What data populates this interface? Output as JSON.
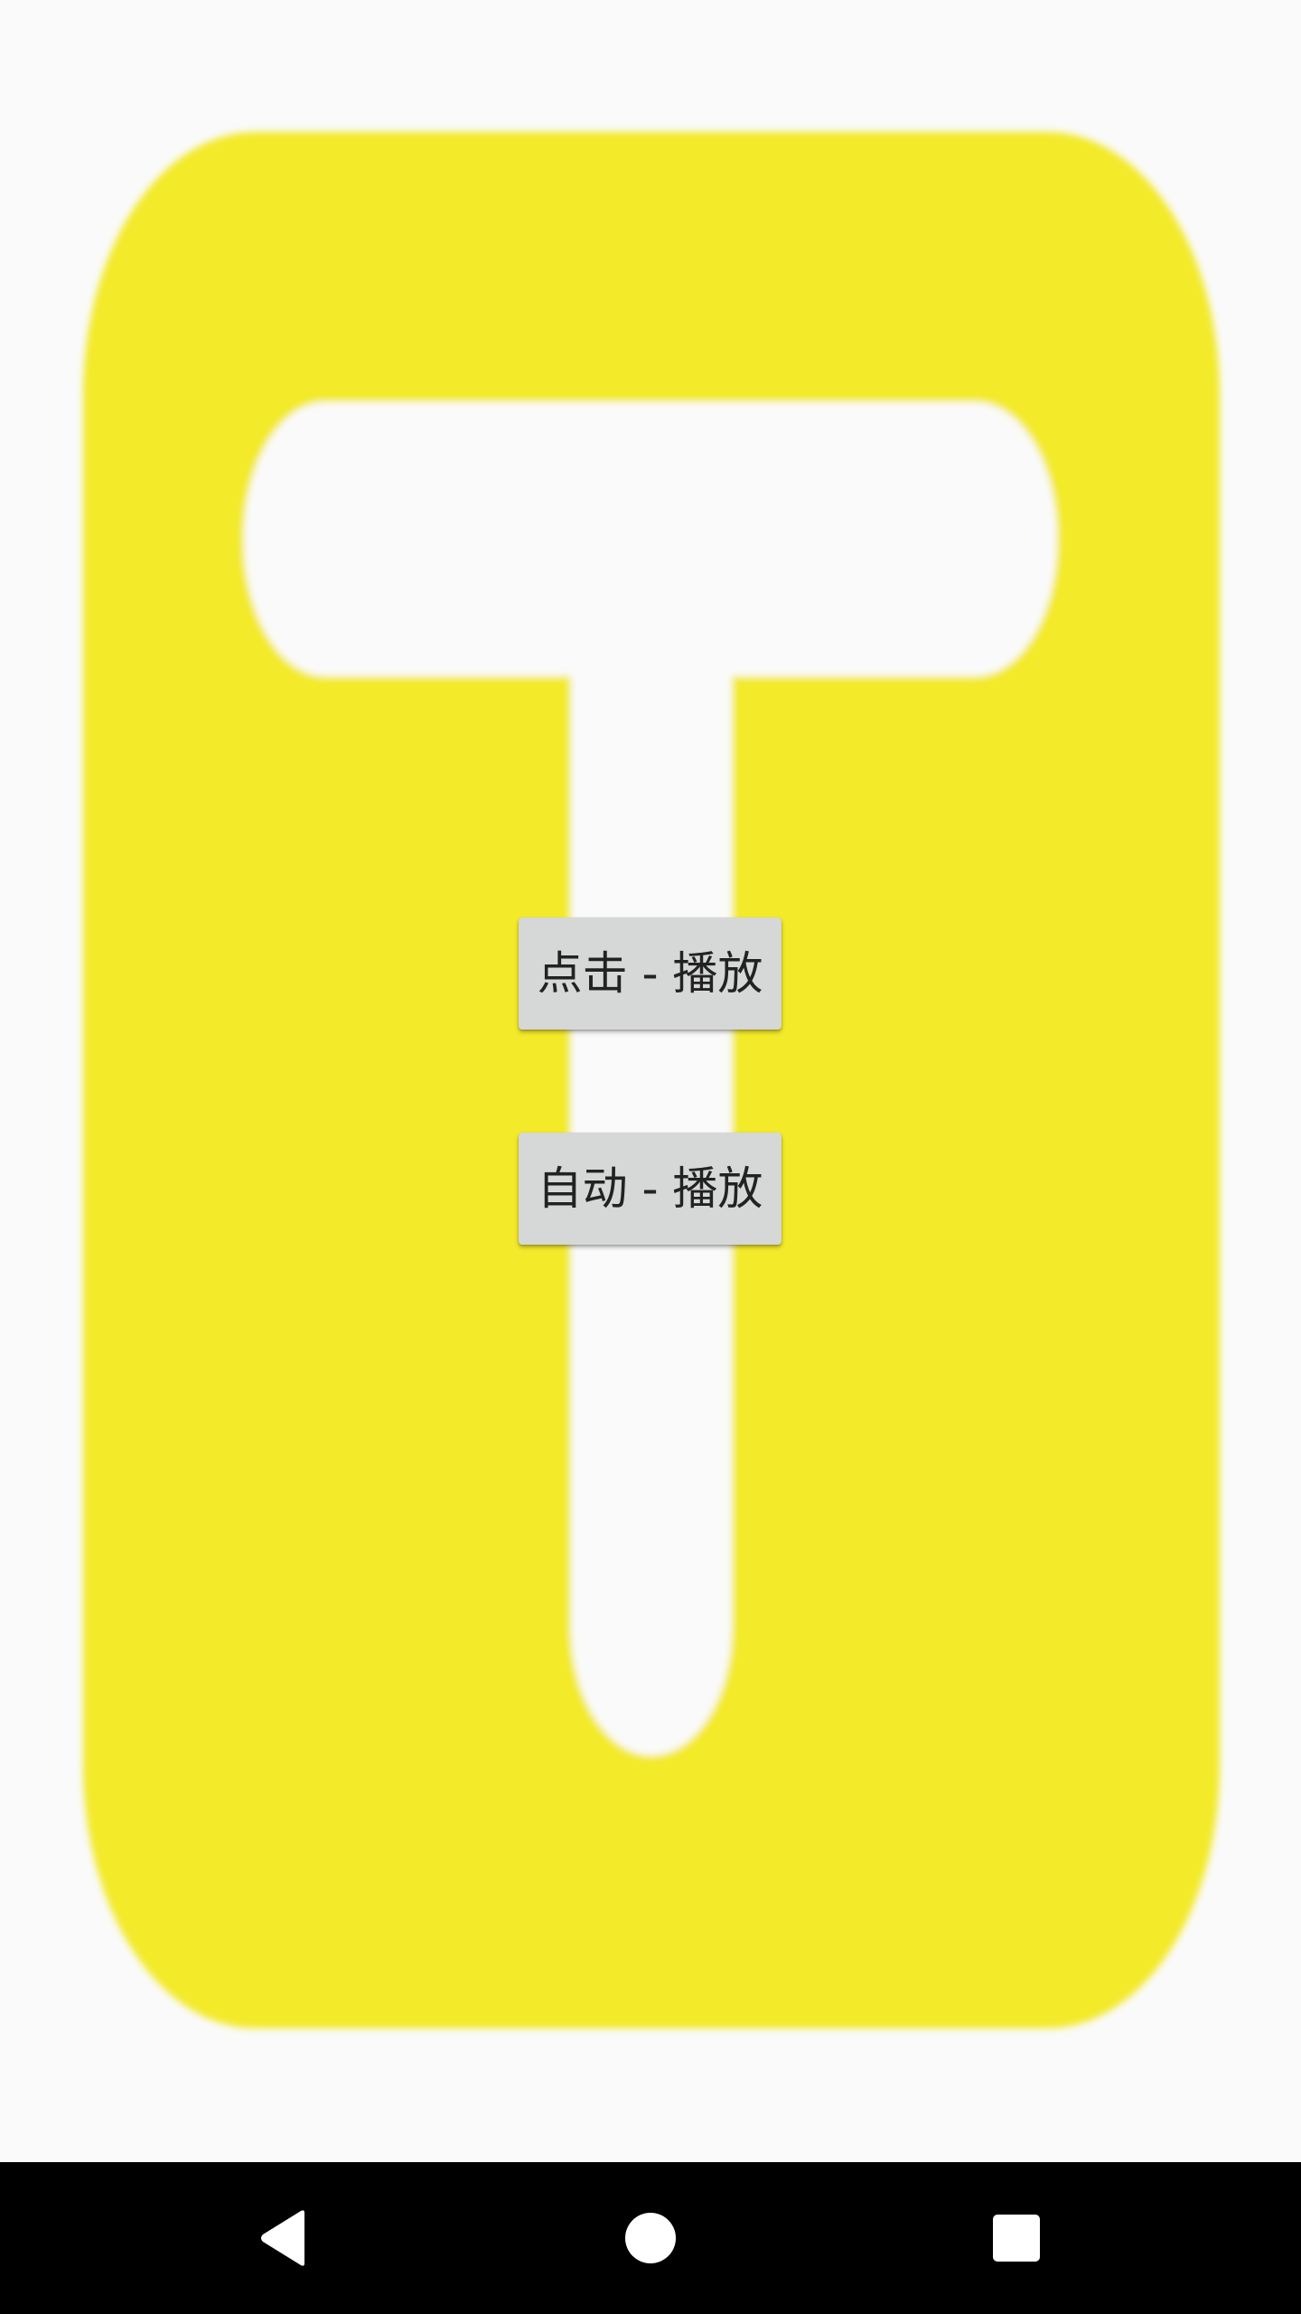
{
  "colors": {
    "background": "#fafafa",
    "logo_yellow": "#f3ea2b",
    "button_bg": "#d6d7d7",
    "button_text": "#222222",
    "navbar_bg": "#000000",
    "navbar_icon": "#ffffff"
  },
  "main": {
    "logo_icon": "t-logo-icon",
    "buttons": {
      "click_play_label": "点击 - 播放",
      "auto_play_label": "自动 - 播放"
    }
  },
  "navbar": {
    "back_icon": "back-triangle-icon",
    "home_icon": "home-circle-icon",
    "recents_icon": "recents-square-icon"
  }
}
